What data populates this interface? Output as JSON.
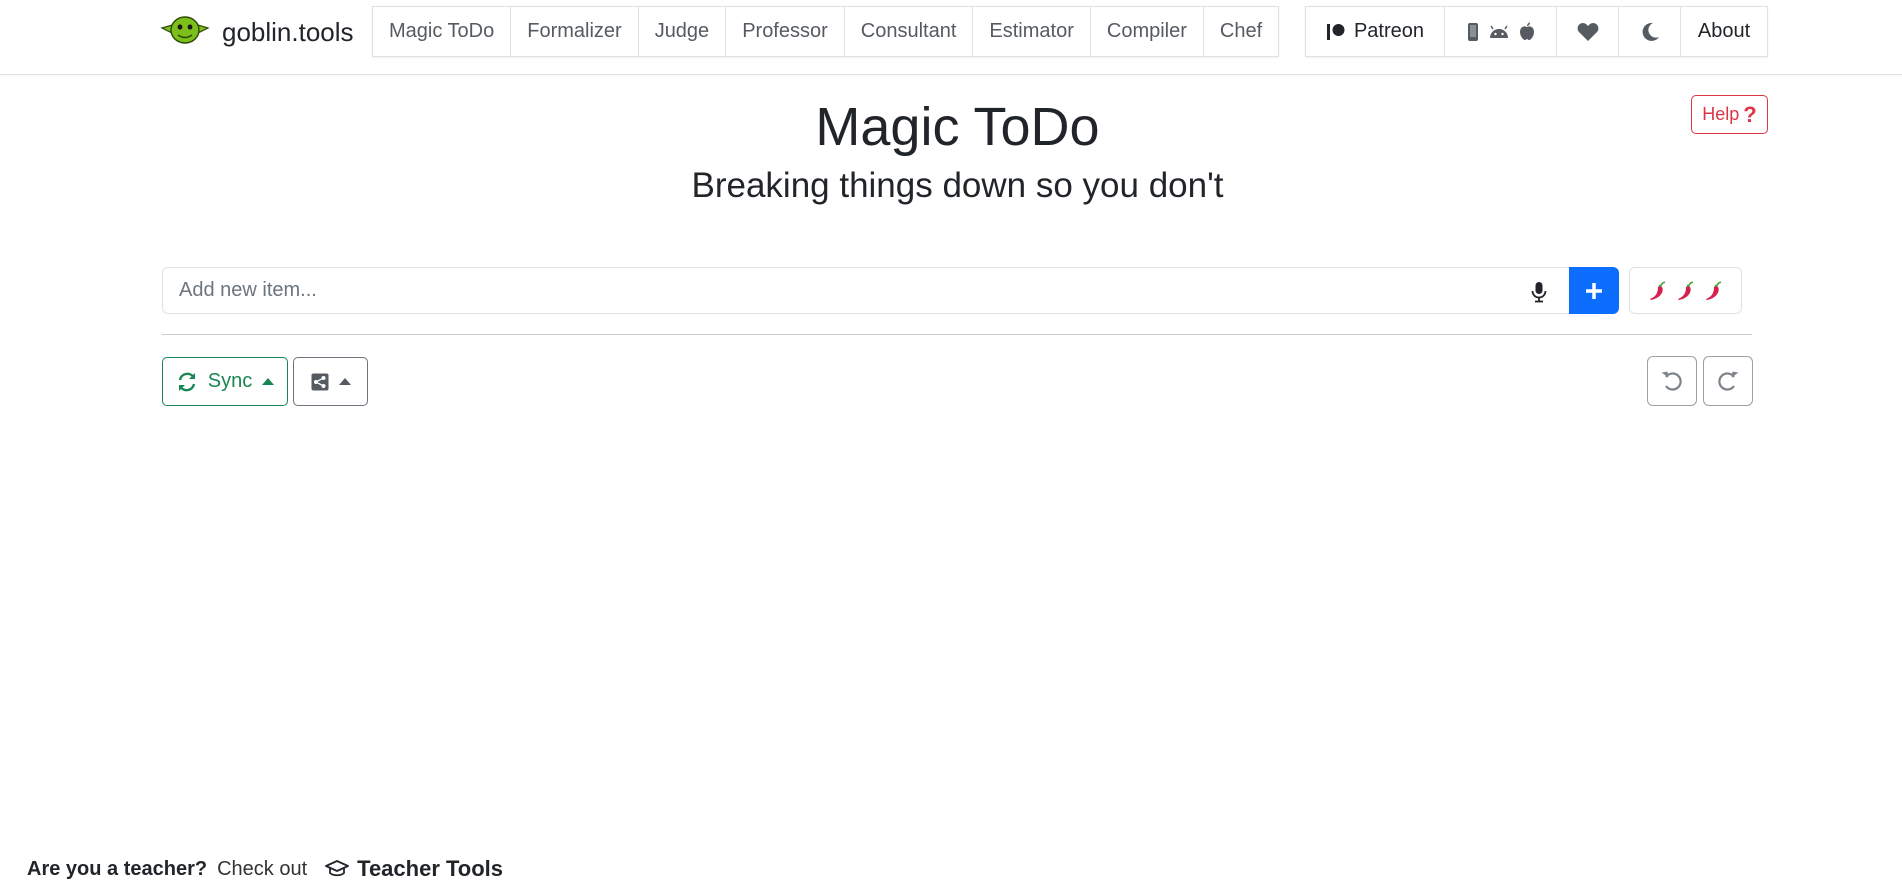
{
  "brand": {
    "name": "goblin.tools",
    "logo_icon": "goblin-logo-icon",
    "logo_color": "#7cbf1a"
  },
  "nav": {
    "tools": [
      {
        "id": "magic-todo",
        "label": "Magic ToDo"
      },
      {
        "id": "formalizer",
        "label": "Formalizer"
      },
      {
        "id": "judge",
        "label": "Judge"
      },
      {
        "id": "professor",
        "label": "Professor"
      },
      {
        "id": "consultant",
        "label": "Consultant"
      },
      {
        "id": "estimator",
        "label": "Estimator"
      },
      {
        "id": "compiler",
        "label": "Compiler"
      },
      {
        "id": "chef",
        "label": "Chef"
      }
    ],
    "right": {
      "patreon_label": "Patreon",
      "patreon_icon": "patreon-icon",
      "apps_icons": [
        "mobile-icon",
        "android-icon",
        "apple-icon"
      ],
      "heart_icon": "heart-icon",
      "theme_icon": "moon-icon",
      "about_label": "About"
    }
  },
  "help": {
    "label": "Help",
    "icon": "question-icon",
    "color": "#dc3545"
  },
  "main": {
    "title": "Magic ToDo",
    "subtitle": "Breaking things down so you don't",
    "input": {
      "placeholder": "Add new item...",
      "value": ""
    },
    "add_button_color": "#0d6efd",
    "spiciness_icons": [
      "chili-pepper-icon",
      "chili-pepper-icon",
      "chili-pepper-icon"
    ]
  },
  "toolbar": {
    "sync_label": "Sync",
    "sync_color": "#198754",
    "share_icon": "share-icon",
    "undo_icon": "undo-icon",
    "redo_icon": "redo-icon"
  },
  "footer": {
    "question": "Are you a teacher?",
    "check_out": "Check out",
    "teacher_tools": "Teacher Tools"
  }
}
